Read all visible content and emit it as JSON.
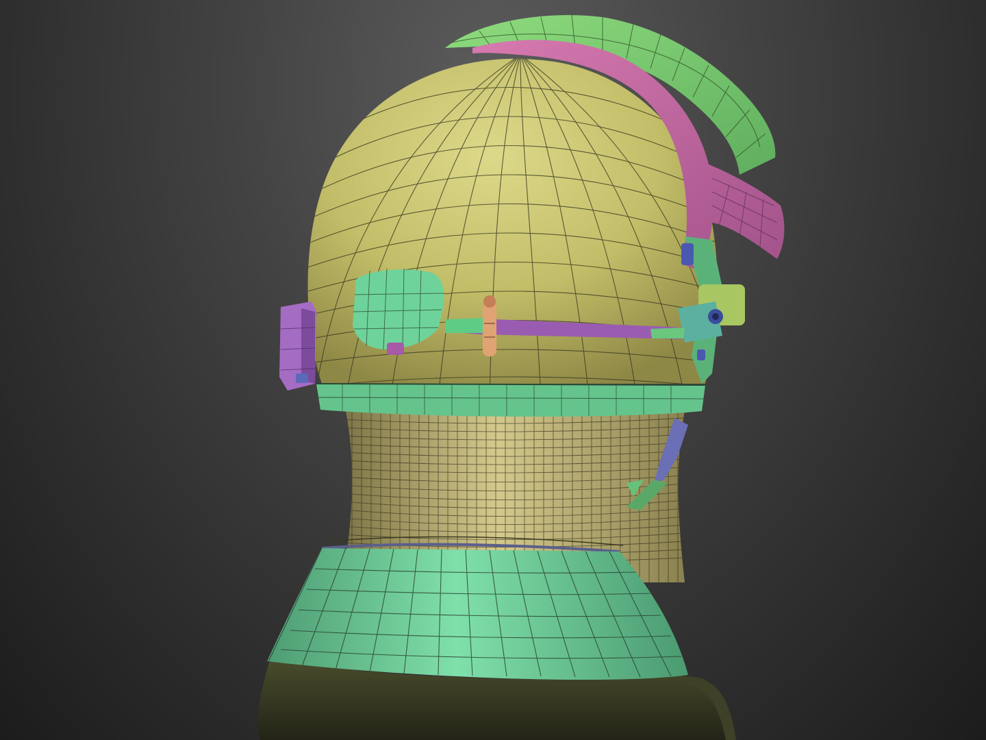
{
  "scene": {
    "subject": "helmet-mesh-render",
    "parts": [
      {
        "name": "helmet-shell",
        "color": "#c9c46e"
      },
      {
        "name": "visor-top",
        "color": "#8fcf78"
      },
      {
        "name": "visor-frame",
        "color": "#cc6ea3"
      },
      {
        "name": "helmet-rim",
        "color": "#6fcf94"
      },
      {
        "name": "side-pod",
        "color": "#6fcf94"
      },
      {
        "name": "side-box",
        "color": "#a56cc4"
      },
      {
        "name": "mic-boom",
        "color": "#9a5cb0"
      },
      {
        "name": "clip",
        "color": "#e0a373"
      },
      {
        "name": "neck-wrap",
        "color": "#cfc57e"
      },
      {
        "name": "collar",
        "color": "#6ed39a"
      }
    ],
    "background": "#3a3a3a",
    "wire_color": "#2a2f22"
  }
}
